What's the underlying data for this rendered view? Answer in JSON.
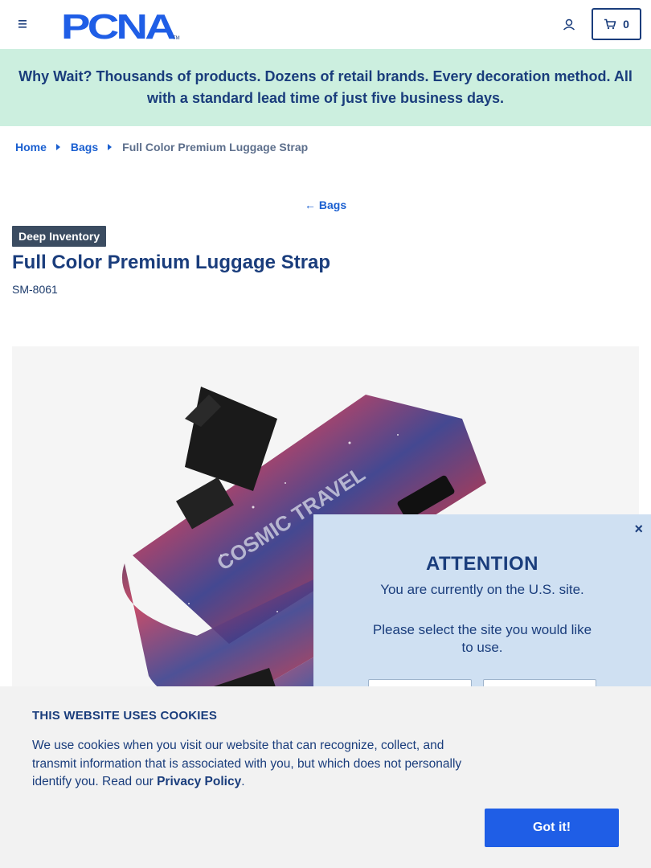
{
  "header": {
    "logo_text": "PCNA",
    "cart_count": "0"
  },
  "banner": {
    "text": "Why Wait? Thousands of products. Dozens of retail brands. Every decoration method. All with a standard lead time of just five business days."
  },
  "breadcrumb": {
    "items": [
      "Home",
      "Bags"
    ],
    "current": "Full Color Premium Luggage Strap"
  },
  "back_link": {
    "label": "Bags"
  },
  "product": {
    "badge": "Deep Inventory",
    "title": "Full Color Premium Luggage Strap",
    "sku": "SM-8061",
    "strap_text": "COSMIC TRAVEL"
  },
  "modal": {
    "close_glyph": "×",
    "title": "ATTENTION",
    "line1": "You are currently on the U.S. site.",
    "line2": "Please select the site you would like to use."
  },
  "cookie": {
    "title": "THIS WEBSITE USES COOKIES",
    "text": "We use cookies when you visit our website that can recognize, collect, and transmit information that is associated with you, but which does not personally identify you. Read our ",
    "link": "Privacy Policy",
    "period": ".",
    "button": "Got it!"
  },
  "colors": {
    "primary": "#1a3d7c",
    "link": "#1a5fd0",
    "banner_bg": "#ccefdf",
    "modal_bg": "#cfe0f2",
    "button": "#1f5ee6",
    "badge_bg": "#3b4c61"
  }
}
